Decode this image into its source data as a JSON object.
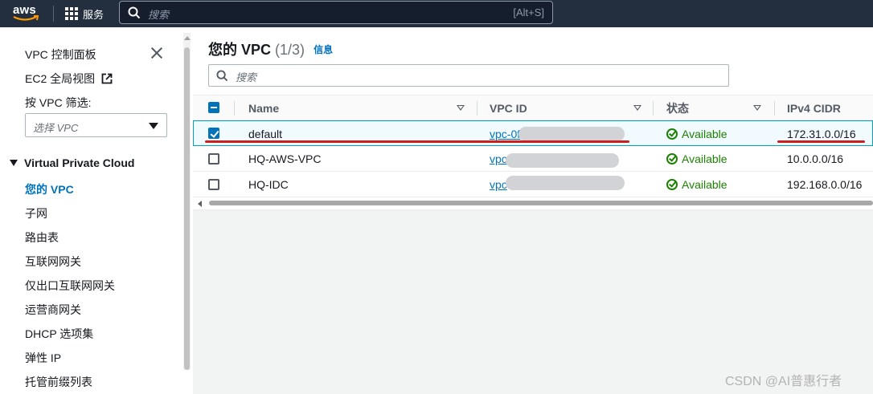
{
  "topnav": {
    "logo_text": "aws",
    "services_label": "服务",
    "search_placeholder": "搜索",
    "search_shortcut": "[Alt+S]"
  },
  "sidebar": {
    "dashboard_label": "VPC 控制面板",
    "ec2_global_view_label": "EC2 全局视图",
    "filter_by_vpc_label": "按 VPC 筛选:",
    "select_vpc_placeholder": "选择 VPC",
    "section_title": "Virtual Private Cloud",
    "items": [
      {
        "label": "您的 VPC",
        "active": true
      },
      {
        "label": "子网"
      },
      {
        "label": "路由表"
      },
      {
        "label": "互联网网关"
      },
      {
        "label": "仅出口互联网网关"
      },
      {
        "label": "运营商网关"
      },
      {
        "label": "DHCP 选项集"
      },
      {
        "label": "弹性 IP"
      },
      {
        "label": "托管前缀列表"
      }
    ]
  },
  "main": {
    "title": "您的 VPC",
    "count": "(1/3)",
    "info_link": "信息",
    "filter_placeholder": "搜索",
    "columns": [
      "Name",
      "VPC ID",
      "状态",
      "IPv4 CIDR"
    ],
    "rows": [
      {
        "name": "default",
        "vpc_id": "vpc-0f",
        "status": "Available",
        "cidr": "172.31.0.0/16",
        "selected": true
      },
      {
        "name": "HQ-AWS-VPC",
        "vpc_id": "vpc",
        "status": "Available",
        "cidr": "10.0.0.0/16",
        "selected": false
      },
      {
        "name": "HQ-IDC",
        "vpc_id": "vpc",
        "status": "Available",
        "cidr": "192.168.0.0/16",
        "selected": false
      }
    ]
  },
  "watermark": "CSDN @AI普惠行者",
  "colors": {
    "topnav_bg": "#232f3e",
    "link_blue": "#0073bb",
    "status_green": "#1d8102",
    "annotation_red": "#cc1f1f"
  }
}
